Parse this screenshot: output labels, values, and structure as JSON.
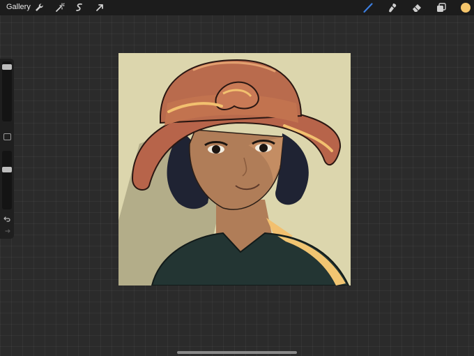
{
  "topbar": {
    "gallery_label": "Gallery",
    "left_tools": [
      "wrench-icon",
      "magic-wand-icon",
      "selection-icon",
      "transform-arrow-icon"
    ],
    "right_tools": [
      "brush-icon",
      "smudge-icon",
      "eraser-icon",
      "layers-icon",
      "color-swatch"
    ]
  },
  "colors": {
    "active_tool": "#3d7fe0",
    "current_color": "#f5c56b",
    "canvas_background": "#dcd6ad"
  },
  "sidebar": {
    "brush_size_level": 0.95,
    "opacity_level": 0.7,
    "tools": [
      "modify-button",
      "undo-icon",
      "redo-icon"
    ]
  },
  "canvas": {
    "artwork": "illustration-portrait"
  }
}
